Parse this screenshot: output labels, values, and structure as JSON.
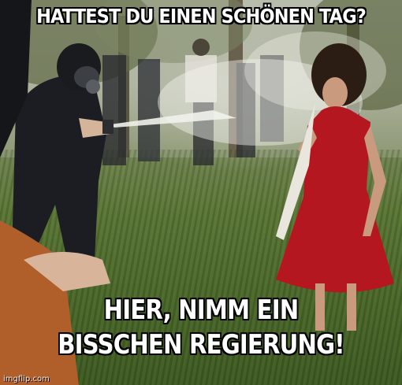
{
  "meme": {
    "top_text": "HATTEST DU EINEN SCHÖNEN TAG?",
    "bottom_text_line1": "HIER,  NIMM EIN",
    "bottom_text_line2": "BISSCHEN REGIERUNG!",
    "watermark": "imgflip.com"
  },
  "colors": {
    "dress": "#b4171f",
    "uniform": "#1b1d22",
    "grass": "#4f6b2e",
    "spray": "#e8ece4"
  }
}
